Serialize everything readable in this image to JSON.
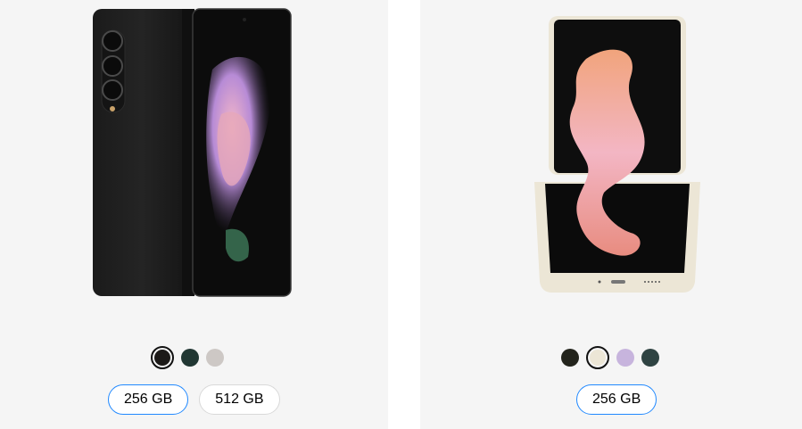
{
  "products": [
    {
      "image_icon": "phone-fold-black-icon",
      "colors": [
        "#1c1a18",
        "#213733",
        "#cdc8c5"
      ],
      "selected_color_index": 0,
      "storage": [
        {
          "label": "256 GB",
          "selected": true
        },
        {
          "label": "512 GB",
          "selected": false
        }
      ]
    },
    {
      "image_icon": "phone-flip-cream-icon",
      "colors": [
        "#23241c",
        "#ece6d6",
        "#c7b4dd",
        "#2f4342"
      ],
      "selected_color_index": 1,
      "storage": [
        {
          "label": "256 GB",
          "selected": true
        }
      ]
    }
  ],
  "colors": {
    "selected_outline": "#2189ff",
    "card_background": "#f5f5f5"
  }
}
